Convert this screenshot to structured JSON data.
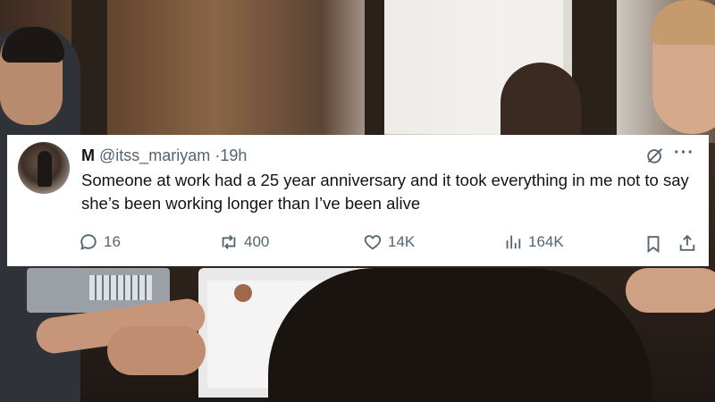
{
  "tweet": {
    "display_name": "M",
    "handle": "@itss_mariyam",
    "separator": "·",
    "time": "19h",
    "text": "Someone at work had a 25 year anniversary and it took everything in me not to say she’s been working longer than I’ve been alive",
    "more_glyph": "···"
  },
  "actions": {
    "replies": "16",
    "reposts": "400",
    "likes": "14K",
    "views": "164K"
  },
  "icons": {
    "reply": "reply-icon",
    "repost": "repost-icon",
    "like": "heart-icon",
    "views": "views-bar-chart-icon",
    "bookmark": "bookmark-icon",
    "share": "share-icon",
    "grok": "grok-icon",
    "more": "more-icon"
  }
}
